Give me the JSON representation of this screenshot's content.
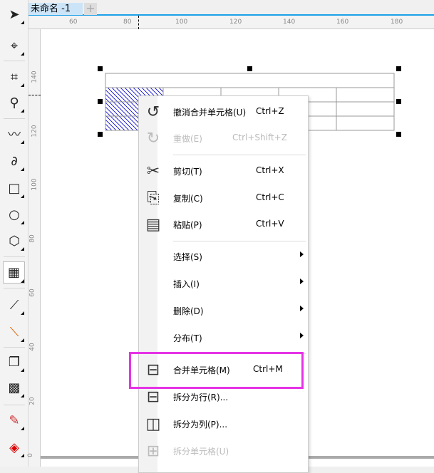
{
  "document": {
    "tab_title": "未命名 -1",
    "add_tab": "+"
  },
  "ruler": {
    "unit": "px",
    "h_labels": [
      "60",
      "80",
      "100",
      "120",
      "140",
      "160",
      "180"
    ],
    "v_labels": [
      "140",
      "120",
      "100",
      "80",
      "60",
      "40",
      "20",
      "0"
    ]
  },
  "toolbar": {
    "tools": [
      "pick-tool",
      "shape-tool",
      "crop-tool",
      "zoom-tool",
      "freehand-tool",
      "artistic-media-tool",
      "rectangle-tool",
      "ellipse-tool",
      "polygon-tool",
      "table-tool",
      "dimension-tool",
      "connector-tool",
      "drop-shadow-tool",
      "transparency-tool",
      "eyedropper-tool",
      "interactive-fill-tool"
    ],
    "active": "table-tool"
  },
  "context_menu": {
    "items": [
      {
        "label": "撤消合并单元格(U)",
        "shortcut": "Ctrl+Z",
        "icon": "undo-icon",
        "enabled": true
      },
      {
        "label": "重做(E)",
        "shortcut": "Ctrl+Shift+Z",
        "icon": "redo-icon",
        "enabled": false
      },
      {
        "label": "剪切(T)",
        "shortcut": "Ctrl+X",
        "icon": "cut-icon",
        "enabled": true
      },
      {
        "label": "复制(C)",
        "shortcut": "Ctrl+C",
        "icon": "copy-icon",
        "enabled": true
      },
      {
        "label": "粘贴(P)",
        "shortcut": "Ctrl+V",
        "icon": "paste-icon",
        "enabled": true
      },
      {
        "label": "选择(S)",
        "submenu": true
      },
      {
        "label": "插入(I)",
        "submenu": true
      },
      {
        "label": "删除(D)",
        "submenu": true
      },
      {
        "label": "分布(T)",
        "submenu": true
      },
      {
        "label": "合并单元格(M)",
        "shortcut": "Ctrl+M",
        "icon": "merge-cells-icon",
        "enabled": true,
        "highlighted": true
      },
      {
        "label": "拆分为行(R)...",
        "icon": "split-rows-icon",
        "enabled": true
      },
      {
        "label": "拆分为列(P)...",
        "icon": "split-columns-icon",
        "enabled": true
      },
      {
        "label": "拆分单元格(U)",
        "icon": "split-cells-icon",
        "enabled": false
      }
    ]
  },
  "colors": {
    "highlight_border": "#e633e6",
    "tab_accent": "#1aa0e8",
    "hatch": "#0000cc"
  }
}
